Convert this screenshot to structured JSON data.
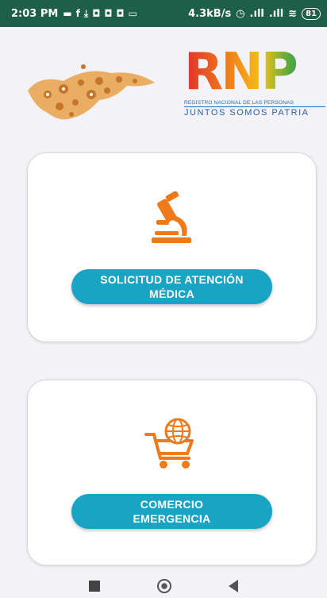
{
  "status_bar": {
    "time": "2:03 PM",
    "network_speed": "4.3kB/s",
    "battery": "81"
  },
  "header": {
    "logo_text": "RNP",
    "logo_subtitle": "REGISTRO NACIONAL DE LAS PERSONAS",
    "logo_slogan": "JUNTOS SOMOS PATRIA"
  },
  "cards": [
    {
      "icon": "microscope-icon",
      "button_line1": "SOLICITUD DE ATENCIÓN",
      "button_line2": "MÉDICA"
    },
    {
      "icon": "shopping-cart-globe-icon",
      "button_line1": "COMERCIO",
      "button_line2": "EMERGENCIA"
    }
  ],
  "colors": {
    "status_bar": "#1e5f4a",
    "background": "#f3f2f7",
    "button": "#1aa4c3",
    "icon_orange": "#f07a1a"
  }
}
